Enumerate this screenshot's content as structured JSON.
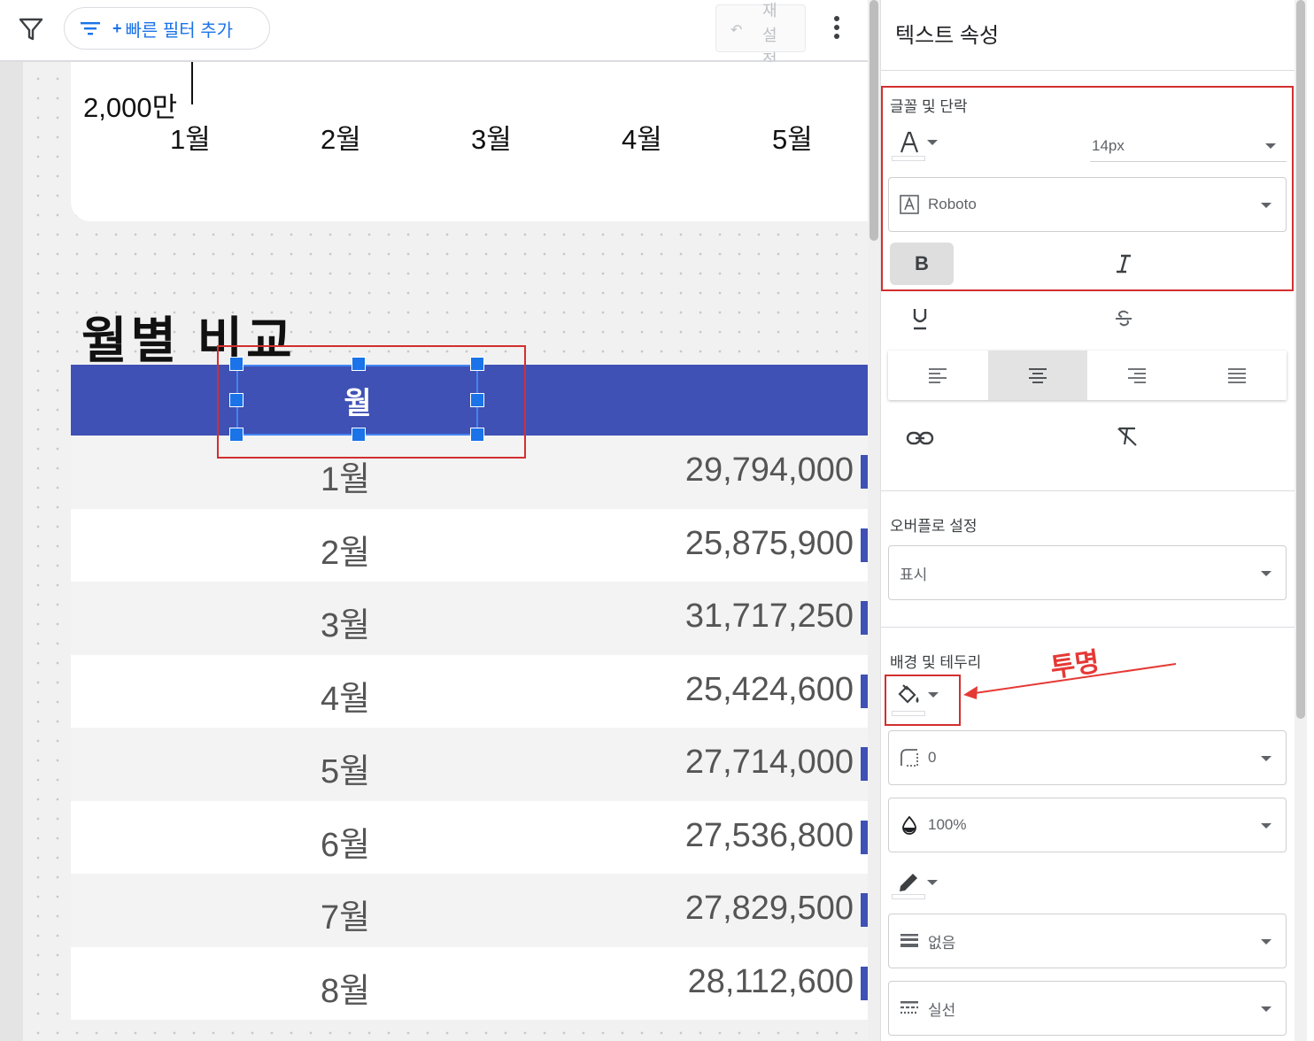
{
  "toolbar": {
    "quick_filter_plus": "+",
    "quick_filter_label": "빠른 필터 추가",
    "reset_label": "재설정"
  },
  "chart": {
    "y_tick": "2,000만",
    "x_ticks": [
      "1월",
      "2월",
      "3월",
      "4월",
      "5월"
    ]
  },
  "section": {
    "title": "월별 비교"
  },
  "table": {
    "header_month": "월",
    "rows": [
      {
        "month": "1월",
        "value": "29,794,000"
      },
      {
        "month": "2월",
        "value": "25,875,900"
      },
      {
        "month": "3월",
        "value": "31,717,250"
      },
      {
        "month": "4월",
        "value": "25,424,600"
      },
      {
        "month": "5월",
        "value": "27,714,000"
      },
      {
        "month": "6월",
        "value": "27,536,800"
      },
      {
        "month": "7월",
        "value": "27,829,500"
      },
      {
        "month": "8월",
        "value": "28,112,600"
      }
    ]
  },
  "panel": {
    "title": "텍스트 속성",
    "font_section": "글꼴 및 단락",
    "font_size": "14px",
    "font_family": "Roboto",
    "bold_label": "B",
    "overflow_section": "오버플로 설정",
    "overflow_value": "표시",
    "bg_section": "배경 및 테두리",
    "border_radius": "0",
    "opacity": "100%",
    "border_weight": "없음",
    "border_style": "실선"
  },
  "annotation": {
    "text": "투명"
  },
  "colors": {
    "accent": "#3f51b5",
    "selection": "#1a73e8",
    "annotation": "#e53935"
  }
}
